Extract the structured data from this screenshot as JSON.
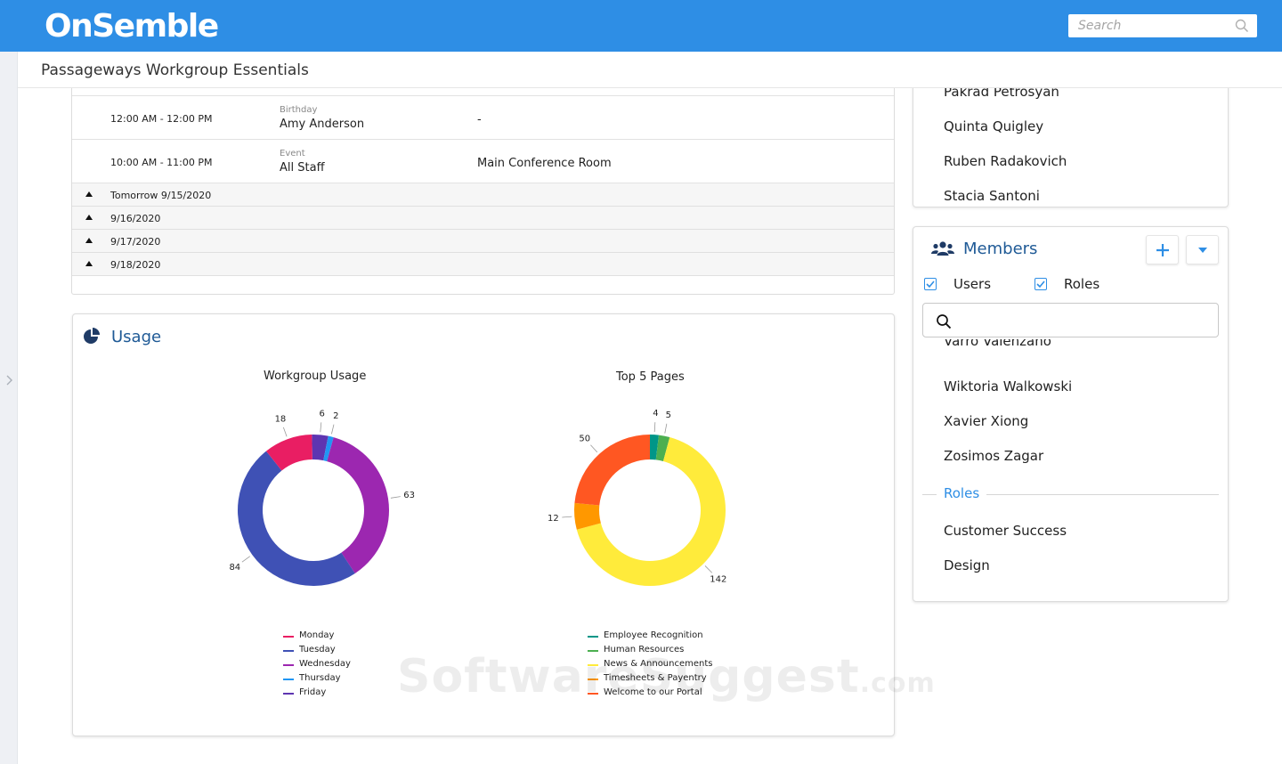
{
  "app": {
    "logo": "OnSemble"
  },
  "search": {
    "placeholder": "Search"
  },
  "page": {
    "title": "Passageways Workgroup Essentials"
  },
  "calendar": {
    "events": [
      {
        "time": "12:00 AM - 12:00 PM",
        "type": "Birthday",
        "name": "Amy Anderson",
        "location": "-"
      },
      {
        "time": "10:00 AM - 11:00 PM",
        "type": "Event",
        "name": "All Staff",
        "location": "Main Conference Room"
      }
    ],
    "days": [
      "Tomorrow 9/15/2020",
      "9/16/2020",
      "9/17/2020",
      "9/18/2020"
    ]
  },
  "usage": {
    "title": "Usage",
    "charts": [
      {
        "title": "Workgroup Usage"
      },
      {
        "title": "Top 5 Pages"
      }
    ]
  },
  "chart_data": [
    {
      "type": "pie",
      "title": "Workgroup Usage",
      "categories": [
        "Monday",
        "Tuesday",
        "Wednesday",
        "Thursday",
        "Friday"
      ],
      "values": [
        18,
        84,
        63,
        2,
        6
      ],
      "colors": [
        "#e91e63",
        "#3f51b5",
        "#9c27b0",
        "#2196f3",
        "#5e35b1"
      ],
      "legend": "bottom"
    },
    {
      "type": "pie",
      "title": "Top 5 Pages",
      "categories": [
        "Employee Recognition",
        "Human Resources",
        "News & Announcements",
        "Timesheets & Payentry",
        "Welcome to our Portal"
      ],
      "values": [
        4,
        5,
        142,
        12,
        50
      ],
      "colors": [
        "#009688",
        "#4caf50",
        "#ffeb3b",
        "#ff9800",
        "#ff5722"
      ],
      "legend": "bottom"
    }
  ],
  "people_top": [
    "Pakrad Petrosyan",
    "Quinta Quigley",
    "Ruben Radakovich",
    "Stacia Santoni"
  ],
  "members": {
    "title": "Members",
    "filters": [
      {
        "label": "Users",
        "checked": true
      },
      {
        "label": "Roles",
        "checked": true
      }
    ],
    "users": [
      "Varro Valenzano",
      "Wiktoria Walkowski",
      "Xavier Xiong",
      "Zosimos Zagar"
    ],
    "roles_heading": "Roles",
    "roles": [
      "Customer Success",
      "Design"
    ]
  },
  "watermark": {
    "main": "SoftwareSuggest",
    "suffix": ".com"
  },
  "colors": {
    "topbar": "#2e8ee5",
    "heading": "#1f5a96",
    "accent": "#2e8ee5"
  }
}
